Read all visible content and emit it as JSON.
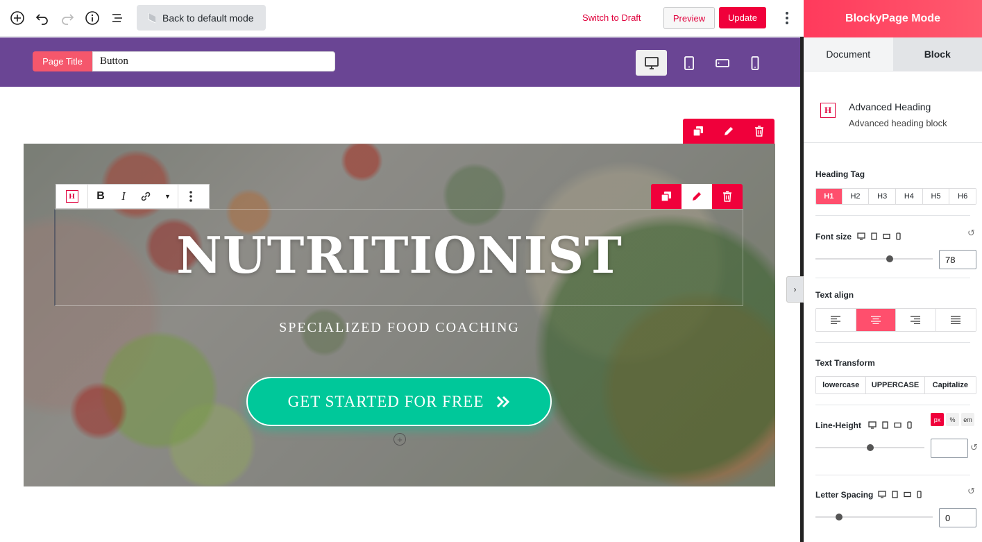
{
  "toolbar": {
    "back_label": "Back to default mode",
    "switch_draft": "Switch to Draft",
    "preview": "Preview",
    "update": "Update"
  },
  "page_title": {
    "label": "Page Title",
    "value": "Button"
  },
  "hero": {
    "title": "NUTRITIONIST",
    "subtitle": "SPECIALIZED FOOD COACHING",
    "cta": "GET STARTED FOR FREE",
    "heading_block_icon": "H"
  },
  "sidebar": {
    "header": "BlockyPage Mode",
    "tabs": [
      "Document",
      "Block"
    ],
    "block_name": "Advanced Heading",
    "block_desc": "Advanced heading block",
    "block_icon": "H",
    "heading_tag_label": "Heading Tag",
    "heading_tags": [
      "H1",
      "H2",
      "H3",
      "H4",
      "H5",
      "H6"
    ],
    "heading_tag_selected": "H1",
    "font_size_label": "Font size",
    "font_size_value": "78",
    "text_align_label": "Text align",
    "text_align_selected": "center",
    "text_transform_label": "Text Transform",
    "text_transforms": [
      "lowercase",
      "UPPERCASE",
      "Capitalize"
    ],
    "line_height_label": "Line-Height",
    "line_height_units": [
      "px",
      "%",
      "em"
    ],
    "line_height_unit_selected": "px",
    "line_height_value": "",
    "letter_spacing_label": "Letter Spacing",
    "letter_spacing_value": "0"
  },
  "colors": {
    "accent": "#f0003b",
    "purple_bar": "#6a4594",
    "cta": "#00c89a",
    "sidebar_header": "#ff4560"
  }
}
